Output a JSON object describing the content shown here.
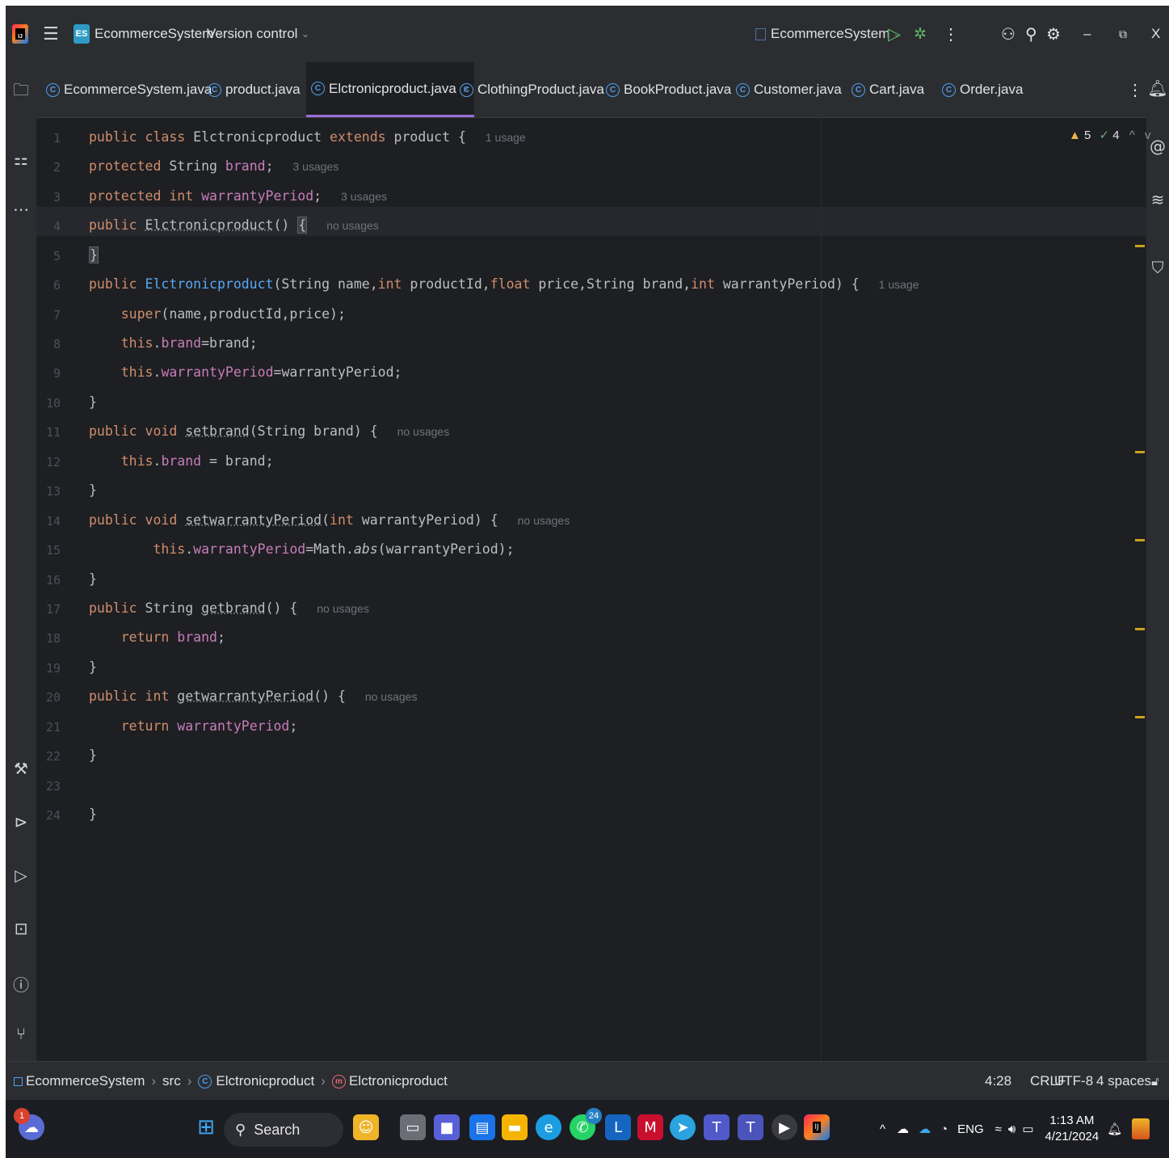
{
  "titlebar": {
    "project_badge": "ES",
    "project_name": "EcommerceSystem",
    "version_control": "Version control",
    "run_config": "EcommerceSystem",
    "minimize": "–",
    "restore": "⧉",
    "close": "X"
  },
  "tabs": [
    {
      "label": "EcommerceSystem.java"
    },
    {
      "label": "product.java"
    },
    {
      "label": "Elctronicproduct.java",
      "close": "×"
    },
    {
      "label": "ClothingProduct.java"
    },
    {
      "label": "BookProduct.java"
    },
    {
      "label": "Customer.java"
    },
    {
      "label": "Cart.java"
    },
    {
      "label": "Order.java"
    }
  ],
  "editor": {
    "line_numbers": [
      "1",
      "2",
      "3",
      "4",
      "5",
      "6",
      "7",
      "8",
      "9",
      "10",
      "11",
      "12",
      "13",
      "14",
      "15",
      "16",
      "17",
      "18",
      "19",
      "20",
      "21",
      "22",
      "23",
      "24"
    ],
    "hints": {
      "l1": "1 usage",
      "l2": "3 usages",
      "l3": "3 usages",
      "l4": "no usages",
      "l6": "1 usage",
      "l11": "no usages",
      "l14": "no usages",
      "l17": "no usages",
      "l20": "no usages"
    },
    "inspection": {
      "warnings": "5",
      "checks": "4"
    }
  },
  "statusbar": {
    "breadcrumb": [
      "EcommerceSystem",
      "src",
      "Elctronicproduct",
      "Elctronicproduct"
    ],
    "position": "4:28",
    "line_sep": "CRLF",
    "encoding": "UTF-8",
    "indent": "4 spaces"
  },
  "taskbar": {
    "search": "Search",
    "whatsapp_badge": "24",
    "lang": "ENG",
    "time": "1:13 AM",
    "date": "4/21/2024",
    "notif_count": "1"
  },
  "colors": {
    "editor_bg": "#1e1f22",
    "chrome_bg": "#2b2d30",
    "keyword": "#cf8e6d",
    "field": "#c77dbb",
    "function": "#56a8f5",
    "active_tab_underline": "#9b6dd9"
  }
}
